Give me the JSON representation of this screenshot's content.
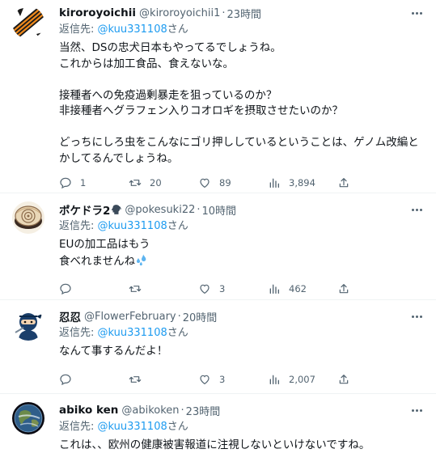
{
  "tweets": [
    {
      "name": "kiroroyoichii",
      "handle": "@kiroroyoichii1",
      "dot": "·",
      "time": "23時間",
      "reply_prefix": "返信先: ",
      "reply_mention": "@kuu331108",
      "reply_suffix": "さん",
      "lines": [
        "当然、DSの忠犬日本もやってるでしょうね。",
        "これからは加工食品、食えないな。",
        "",
        "接種者への免疫過剰暴走を狙っているのか？",
        "非接種者へグラフェン入りコオロギを摂取させたいのか？",
        "",
        "どっちにしろ虫をこんなにゴリ押ししているということは、ゲノム改編と",
        "かしてるんでしょうね。"
      ],
      "replies": "1",
      "retweets": "20",
      "likes": "89",
      "views": "3,894"
    },
    {
      "name": "ポケドラ2",
      "handle": "@pokesuki22",
      "dot": "·",
      "time": "10時間",
      "reply_prefix": "返信先: ",
      "reply_mention": "@kuu331108",
      "reply_suffix": "さん",
      "lines": [
        "EUの加工品はもう",
        "食べれませんね"
      ],
      "replies": "",
      "retweets": "",
      "likes": "3",
      "views": "462"
    },
    {
      "name": "忍忍",
      "handle": "@FlowerFebruary",
      "dot": "·",
      "time": "20時間",
      "reply_prefix": "返信先: ",
      "reply_mention": "@kuu331108",
      "reply_suffix": "さん",
      "lines": [
        "なんて事するんだよ！"
      ],
      "replies": "",
      "retweets": "",
      "likes": "3",
      "views": "2,007"
    },
    {
      "name": "abiko ken",
      "handle": "@abikoken",
      "dot": "·",
      "time": "23時間",
      "reply_prefix": "返信先: ",
      "reply_mention": "@kuu331108",
      "reply_suffix": "さん",
      "lines": [
        "これは、、欧州の健康被害報道に注視しないといけないですね。"
      ],
      "replies": "",
      "retweets": "",
      "likes": "",
      "views": ""
    }
  ],
  "colors": {
    "text": "#0f1419",
    "secondary": "#536471",
    "link": "#1d9bf0",
    "border": "#eff3f4"
  },
  "icons": [
    "reply-icon",
    "retweet-icon",
    "like-icon",
    "views-icon",
    "share-icon",
    "more-icon",
    "speech-head-icon",
    "droplets-icon"
  ]
}
